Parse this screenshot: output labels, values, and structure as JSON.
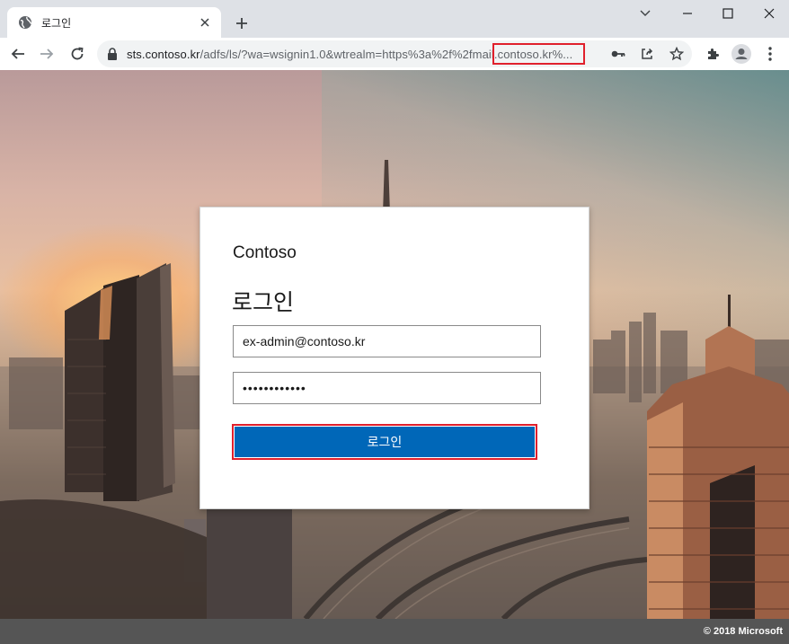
{
  "browser": {
    "tab_title": "로그인",
    "url_main": "sts.contoso.kr",
    "url_rest": "/adfs/ls/?wa=wsignin1.0&wtrealm=https%3a%2f%2fmail.contoso.kr%..."
  },
  "login": {
    "brand": "Contoso",
    "heading": "로그인",
    "username_value": "ex-admin@contoso.kr",
    "password_value": "••••••••••••",
    "submit_label": "로그인"
  },
  "footer": {
    "copyright": "© 2018 Microsoft"
  },
  "colors": {
    "accent": "#0067b8",
    "highlight": "#e0202c"
  },
  "icons": [
    "globe-icon",
    "close-icon",
    "plus-icon",
    "chevron-down-icon",
    "minimize-icon",
    "maximize-icon",
    "back-icon",
    "forward-icon",
    "reload-icon",
    "lock-icon",
    "key-icon",
    "share-icon",
    "star-icon",
    "extensions-icon",
    "profile-icon",
    "menu-icon"
  ]
}
